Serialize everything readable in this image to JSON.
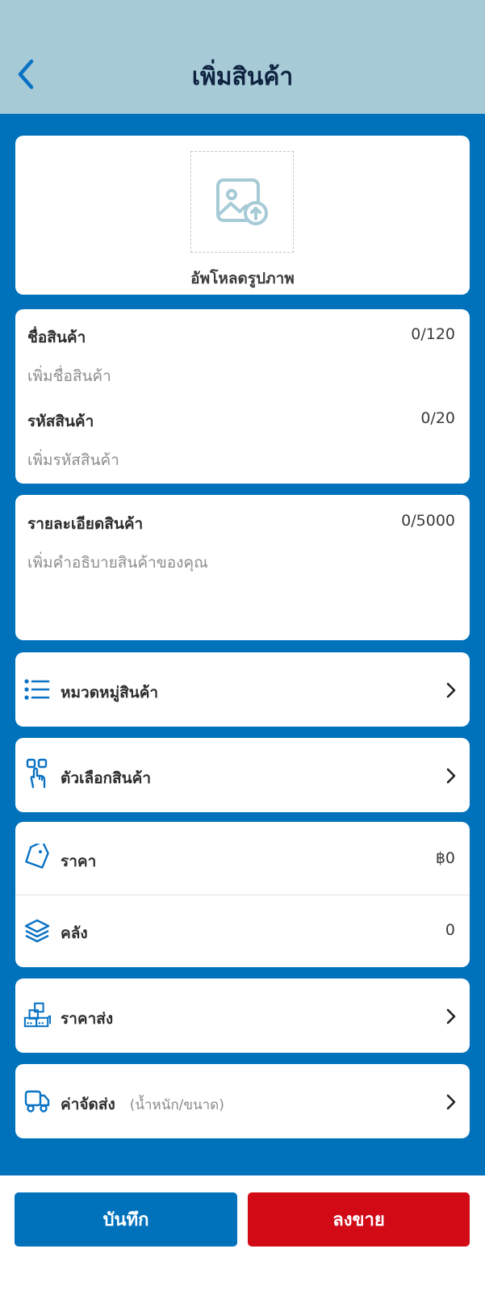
{
  "header": {
    "title": "เพิ่มสินค้า",
    "back_icon": "chevron-left-icon"
  },
  "upload": {
    "icon": "image-upload-icon",
    "label": "อัพโหลดรูปภาพ"
  },
  "fields": {
    "name": {
      "label": "ชื่อสินค้า",
      "count": "0/120",
      "placeholder": "เพิ่มชื่อสินค้า"
    },
    "code": {
      "label": "รหัสสินค้า",
      "count": "0/20",
      "placeholder": "เพิ่มรหัสสินค้า"
    },
    "description": {
      "label": "รายละเอียดสินค้า",
      "count": "0/5000",
      "placeholder": "เพิ่มคำอธิบายสินค้าของคุณ"
    }
  },
  "rows": {
    "category": {
      "label": "หมวดหมู่สินค้า",
      "icon": "list-icon"
    },
    "options": {
      "label": "ตัวเลือกสินค้า",
      "icon": "touch-select-icon"
    },
    "price": {
      "label": "ราคา",
      "value": "฿0",
      "icon": "price-tag-icon"
    },
    "stock": {
      "label": "คลัง",
      "value": "0",
      "icon": "layers-icon"
    },
    "wholesale": {
      "label": "ราคาส่ง",
      "icon": "boxes-icon"
    },
    "shipping": {
      "label": "ค่าจัดส่ง",
      "sub_label": "(น้ำหนัก/ขนาด)",
      "icon": "truck-icon"
    }
  },
  "footer": {
    "save_label": "บันทึก",
    "sell_label": "ลงขาย"
  },
  "colors": {
    "primary": "#0072bc",
    "header_bg": "#a6cbd7",
    "danger": "#d10a16",
    "title_text": "#0f2340"
  }
}
